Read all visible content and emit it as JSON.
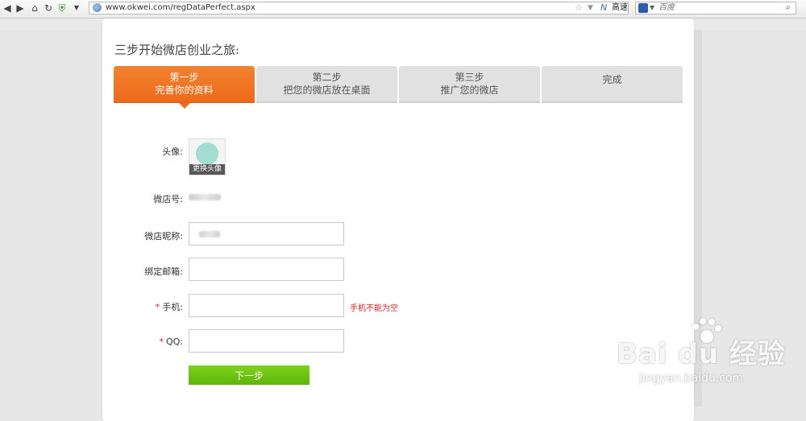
{
  "browser": {
    "url": "www.okwei.com/regDataPerfect.aspx",
    "speed_label": "高速",
    "search_placeholder": "百度"
  },
  "page": {
    "title": "三步开始微店创业之旅:",
    "steps": [
      {
        "line1": "第一步",
        "line2": "完善你的资料",
        "active": true
      },
      {
        "line1": "第二步",
        "line2": "把您的微店放在桌面",
        "active": false
      },
      {
        "line1": "第三步",
        "line2": "推广您的微店",
        "active": false
      },
      {
        "line1": "完成",
        "line2": "",
        "active": false
      }
    ]
  },
  "form": {
    "avatar_label": "头像:",
    "avatar_change": "更换头像",
    "shop_id_label": "微店号:",
    "nickname_label": "微店昵称:",
    "email_label": "绑定邮箱:",
    "phone_required": "*",
    "phone_label": "手机:",
    "phone_error": "手机不能为空",
    "qq_required": "*",
    "qq_label": "QQ:",
    "next_button": "下一步"
  },
  "watermark": {
    "main": "Bai du 经验",
    "sub": "jingyan.baidu.com"
  },
  "colors": {
    "active_step": "#ed6b1a",
    "inactive_step": "#e1e1e1",
    "button_green": "#6cc20f",
    "error_red": "#e02020"
  }
}
